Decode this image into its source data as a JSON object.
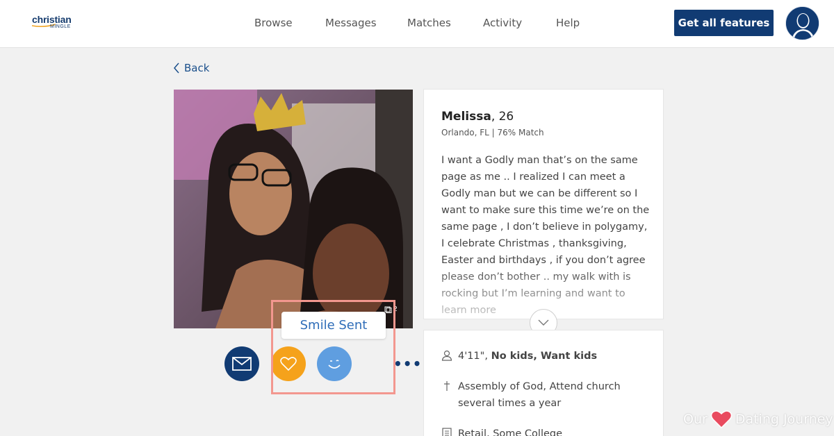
{
  "brand": {
    "logo_top": "christian",
    "logo_bottom": "MINGLE",
    "accent_color": "#113b73",
    "link_color": "#1a4f8b"
  },
  "nav": {
    "items": [
      {
        "label": "Browse"
      },
      {
        "label": "Messages"
      },
      {
        "label": "Matches"
      },
      {
        "label": "Activity"
      },
      {
        "label": "Help"
      }
    ],
    "cta_label": "Get all features"
  },
  "back_label": "Back",
  "photo": {
    "count_icon": "photos-icon",
    "count": "2"
  },
  "actions": {
    "tooltip": "Smile Sent",
    "icons": [
      "envelope-icon",
      "heart-icon",
      "smile-icon"
    ],
    "more": "•••"
  },
  "profile": {
    "name": "Melissa",
    "age": ", 26",
    "subline": "Orlando, FL | 76% Match",
    "bio": "I want a Godly man that’s on the same page as me .. I realized I can meet a Godly man but we can be different so I want to make sure this time we’re on the same page , I don’t believe in polygamy, I celebrate Christmas , thanksgiving, Easter and birthdays , if you don’t agree please don’t bother .. my walk with is rocking but I’m learning and want to learn more"
  },
  "details": {
    "height": "4'11\", ",
    "kids": "No kids, Want kids",
    "faith": "Assembly of God, Attend church several times a year",
    "work": "Retail, Some College"
  },
  "watermark": {
    "left": "Our",
    "right": "Dating Journey",
    "heart_color": "#e94b5f"
  },
  "status_colors": {
    "like": "#f5a21b",
    "smile": "#5f9ee0",
    "highlight": "#f3978f"
  }
}
